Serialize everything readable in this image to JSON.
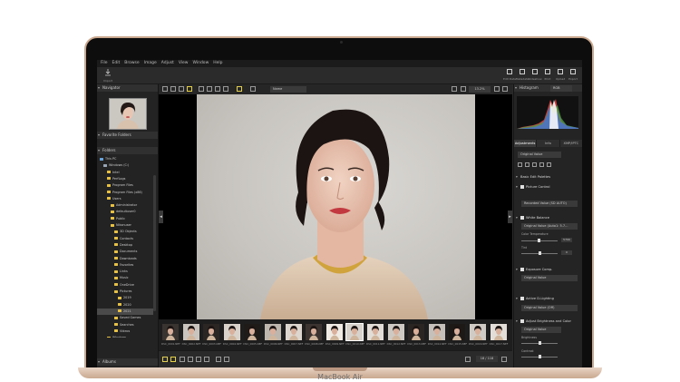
{
  "device": {
    "brand_label": "MacBook Air"
  },
  "menubar": {
    "items": [
      "File",
      "Edit",
      "Browse",
      "Image",
      "Adjust",
      "View",
      "Window",
      "Help"
    ]
  },
  "toolbar": {
    "import_label": "Import",
    "right_buttons": [
      "Edit Data",
      "Metadata",
      "Slideshow",
      "Print",
      "Upload",
      "Export"
    ]
  },
  "left_panel": {
    "navigator_label": "Navigator",
    "favorite_folders_label": "Favorite Folders",
    "folders_label": "Folders",
    "albums_label": "Albums",
    "tree": [
      {
        "label": "This PC",
        "depth": 0
      },
      {
        "label": "Windows (C:)",
        "depth": 1
      },
      {
        "label": "Intel",
        "depth": 2
      },
      {
        "label": "PerfLogs",
        "depth": 2
      },
      {
        "label": "Program Files",
        "depth": 2
      },
      {
        "label": "Program Files (x86)",
        "depth": 2
      },
      {
        "label": "Users",
        "depth": 2
      },
      {
        "label": "Administrator",
        "depth": 3
      },
      {
        "label": "defaultuser0",
        "depth": 3
      },
      {
        "label": "Public",
        "depth": 3
      },
      {
        "label": "Nikonuser",
        "depth": 3
      },
      {
        "label": "3D Objects",
        "depth": 4
      },
      {
        "label": "Contacts",
        "depth": 4
      },
      {
        "label": "Desktop",
        "depth": 4
      },
      {
        "label": "Documents",
        "depth": 4
      },
      {
        "label": "Downloads",
        "depth": 4
      },
      {
        "label": "Favorites",
        "depth": 4
      },
      {
        "label": "Links",
        "depth": 4
      },
      {
        "label": "Music",
        "depth": 4
      },
      {
        "label": "OneDrive",
        "depth": 4
      },
      {
        "label": "Pictures",
        "depth": 4
      },
      {
        "label": "2019",
        "depth": 5
      },
      {
        "label": "2020",
        "depth": 5
      },
      {
        "label": "2021",
        "depth": 5
      },
      {
        "label": "Saved Games",
        "depth": 4
      },
      {
        "label": "Searches",
        "depth": 4
      },
      {
        "label": "Videos",
        "depth": 4
      },
      {
        "label": "Windows",
        "depth": 2
      }
    ],
    "selected_index": 23
  },
  "viewer": {
    "sort_label": "Name",
    "zoom_label": "13.2%",
    "page_indicator": "18 / 118"
  },
  "filmstrip": {
    "items": [
      "DSC_0001.NEF",
      "DSC_0002.NEF",
      "DSC_0003.NEF",
      "DSC_0004.NEF",
      "DSC_0005.NEF",
      "DSC_0006.NEF",
      "DSC_0007.NEF",
      "DSC_0008.NEF",
      "DSC_0009.NEF",
      "DSC_0010.NEF",
      "DSC_0011.NEF",
      "DSC_0012.NEF",
      "DSC_0013.NEF",
      "DSC_0014.NEF",
      "DSC_0015.NEF",
      "DSC_0016.NEF",
      "DSC_0017.NEF"
    ],
    "active_index": 9
  },
  "right_panel": {
    "histogram_label": "Histogram",
    "histogram_channel": "RGB",
    "tabs": [
      "Adjustments",
      "Info",
      "XMP/IPTC"
    ],
    "preset_value": "Original Value",
    "basic_edit_label": "Basic Edit Palettes",
    "picture_control_label": "Picture Control",
    "picture_control_value": "Recorded Value (SD AUTO)",
    "white_balance_label": "White Balance",
    "white_balance_value": "Original Value (Auto1: 5.7...",
    "color_temp_label": "Color Temperature",
    "color_temp_value": "5700",
    "tint_label": "Tint",
    "tint_value": "0",
    "exposure_label": "Exposure Comp.",
    "exposure_value": "Original Value",
    "adl_label": "Active D-Lighting",
    "adl_value": "Original Value (Off)",
    "brightness_label": "Adjust Brightness and Color",
    "brightness_value": "Original Value",
    "brightness_slider_label": "Brightness",
    "contrast_slider_label": "Contrast"
  },
  "colors": {
    "folder": "#e5c04b",
    "frame_gold": "#c9a88f",
    "ui_dark": "#2a2a2a"
  },
  "icons": {
    "import": "download-icon",
    "right_toolbar": [
      "edit-icon",
      "metadata-icon",
      "slideshow-icon",
      "print-icon",
      "upload-icon",
      "export-icon"
    ]
  }
}
